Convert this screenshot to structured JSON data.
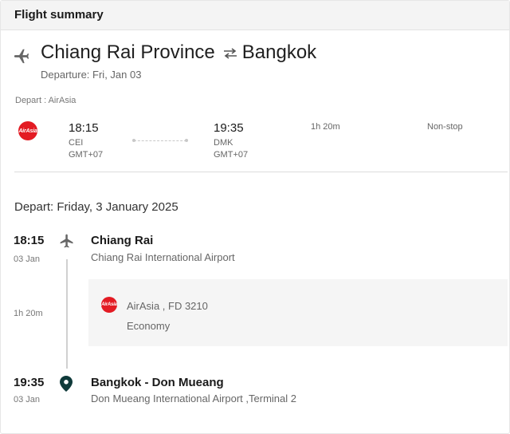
{
  "header": {
    "title": "Flight summary"
  },
  "route": {
    "origin": "Chiang Rai Province",
    "destination": "Bangkok",
    "departure_label": "Departure: Fri, Jan 03"
  },
  "leg": {
    "depart_airline_label": "Depart : AirAsia",
    "airline_logo_text": "AirAsia",
    "departure": {
      "time": "18:15",
      "code": "CEI",
      "tz": "GMT+07"
    },
    "arrival": {
      "time": "19:35",
      "code": "DMK",
      "tz": "GMT+07"
    },
    "duration": "1h 20m",
    "stops": "Non-stop"
  },
  "detail": {
    "depart_heading": "Depart: Friday, 3 January 2025",
    "origin": {
      "time": "18:15",
      "date": "03 Jan",
      "name": "Chiang Rai",
      "airport": "Chiang Rai International Airport"
    },
    "segment": {
      "duration": "1h 20m",
      "airline": "AirAsia , FD 3210",
      "cabin": "Economy"
    },
    "destination": {
      "time": "19:35",
      "date": "03 Jan",
      "name": "Bangkok - Don Mueang",
      "airport": "Don Mueang International Airport ,Terminal 2"
    }
  },
  "colors": {
    "brand_red": "#e31b23",
    "pin": "#0f3a3a",
    "icon_grey": "#666666"
  }
}
